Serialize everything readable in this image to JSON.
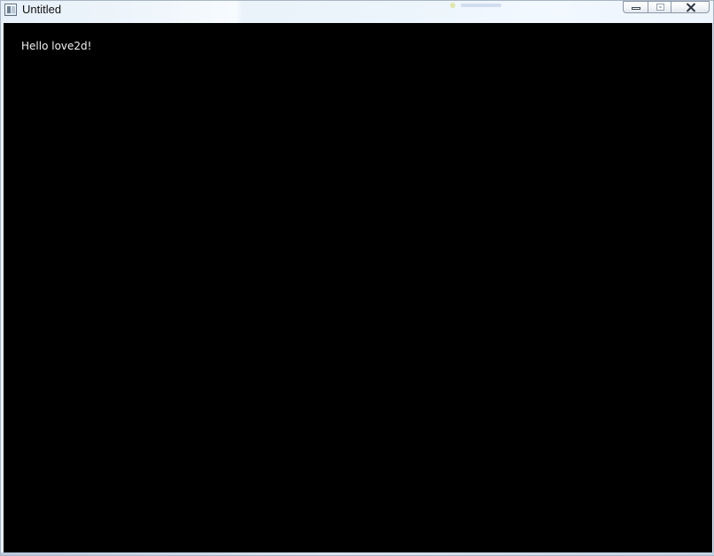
{
  "window": {
    "title": "Untitled",
    "icon": "application-window-icon"
  },
  "window_controls": {
    "minimize_icon": "minimize-icon",
    "maximize_icon": "maximize-icon",
    "close_icon": "close-icon"
  },
  "canvas": {
    "background_color": "#000000",
    "text": "Hello love2d!",
    "text_color": "#f2f2f2"
  }
}
